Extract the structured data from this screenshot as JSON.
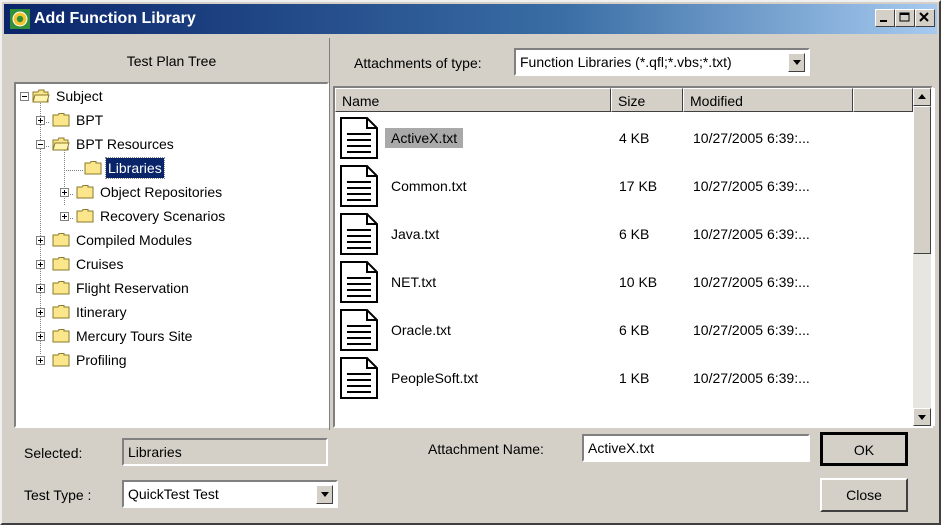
{
  "window": {
    "title": "Add Function Library"
  },
  "tree_panel": {
    "header": "Test Plan Tree",
    "nodes": [
      {
        "label": "Subject"
      },
      {
        "label": "BPT"
      },
      {
        "label": "BPT Resources"
      },
      {
        "label": "Libraries"
      },
      {
        "label": "Object Repositories"
      },
      {
        "label": "Recovery Scenarios"
      },
      {
        "label": "Compiled Modules"
      },
      {
        "label": "Cruises"
      },
      {
        "label": "Flight Reservation"
      },
      {
        "label": "Itinerary"
      },
      {
        "label": "Mercury Tours Site"
      },
      {
        "label": "Profiling"
      }
    ]
  },
  "attachments": {
    "type_label": "Attachments of type:",
    "type_value": "Function Libraries (*.qfl;*.vbs;*.txt)",
    "columns": [
      "Name",
      "Size",
      "Modified"
    ],
    "files": [
      {
        "name": "ActiveX.txt",
        "size": "4 KB",
        "modified": "10/27/2005 6:39:..."
      },
      {
        "name": "Common.txt",
        "size": "17 KB",
        "modified": "10/27/2005 6:39:..."
      },
      {
        "name": "Java.txt",
        "size": "6 KB",
        "modified": "10/27/2005 6:39:..."
      },
      {
        "name": "NET.txt",
        "size": "10 KB",
        "modified": "10/27/2005 6:39:..."
      },
      {
        "name": "Oracle.txt",
        "size": "6 KB",
        "modified": "10/27/2005 6:39:..."
      },
      {
        "name": "PeopleSoft.txt",
        "size": "1 KB",
        "modified": "10/27/2005 6:39:..."
      }
    ]
  },
  "footer": {
    "selected_label": "Selected:",
    "selected_value": "Libraries",
    "test_type_label": "Test Type :",
    "test_type_value": "QuickTest Test",
    "attachment_name_label": "Attachment Name:",
    "attachment_name_value": "ActiveX.txt",
    "ok_label": "OK",
    "close_label": "Close"
  },
  "icons": {
    "app": "qtp-logo-icon",
    "minimize": "minimize-icon",
    "maximize": "maximize-icon",
    "close": "close-icon",
    "folder": "folder-icon",
    "open_folder": "open-folder-icon",
    "document": "text-document-icon"
  }
}
